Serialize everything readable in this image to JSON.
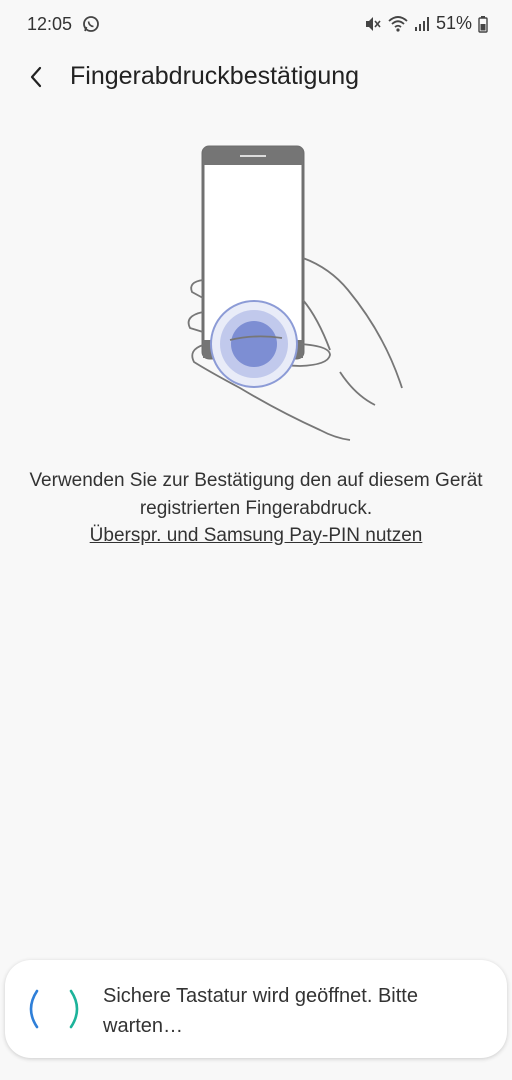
{
  "status_bar": {
    "time": "12:05",
    "battery": "51%",
    "icons": [
      "whatsapp-icon",
      "mute-icon",
      "wifi-icon",
      "signal-icon",
      "battery-icon"
    ]
  },
  "header": {
    "title": "Fingerabdruckbestätigung",
    "back_icon": "back-arrow-icon"
  },
  "main": {
    "instruction": "Verwenden Sie zur Bestätigung den auf diesem Gerät registrierten Fingerabdruck.",
    "skip_link": "Überspr. und Samsung Pay-PIN nutzen"
  },
  "toast": {
    "message": "Sichere Tastatur wird geöffnet. Bitte warten…"
  },
  "colors": {
    "background": "#f8f8f8",
    "accent_blue": "#5b6fc4",
    "spinner_blue": "#2f7fd8",
    "spinner_teal": "#1db39a"
  }
}
